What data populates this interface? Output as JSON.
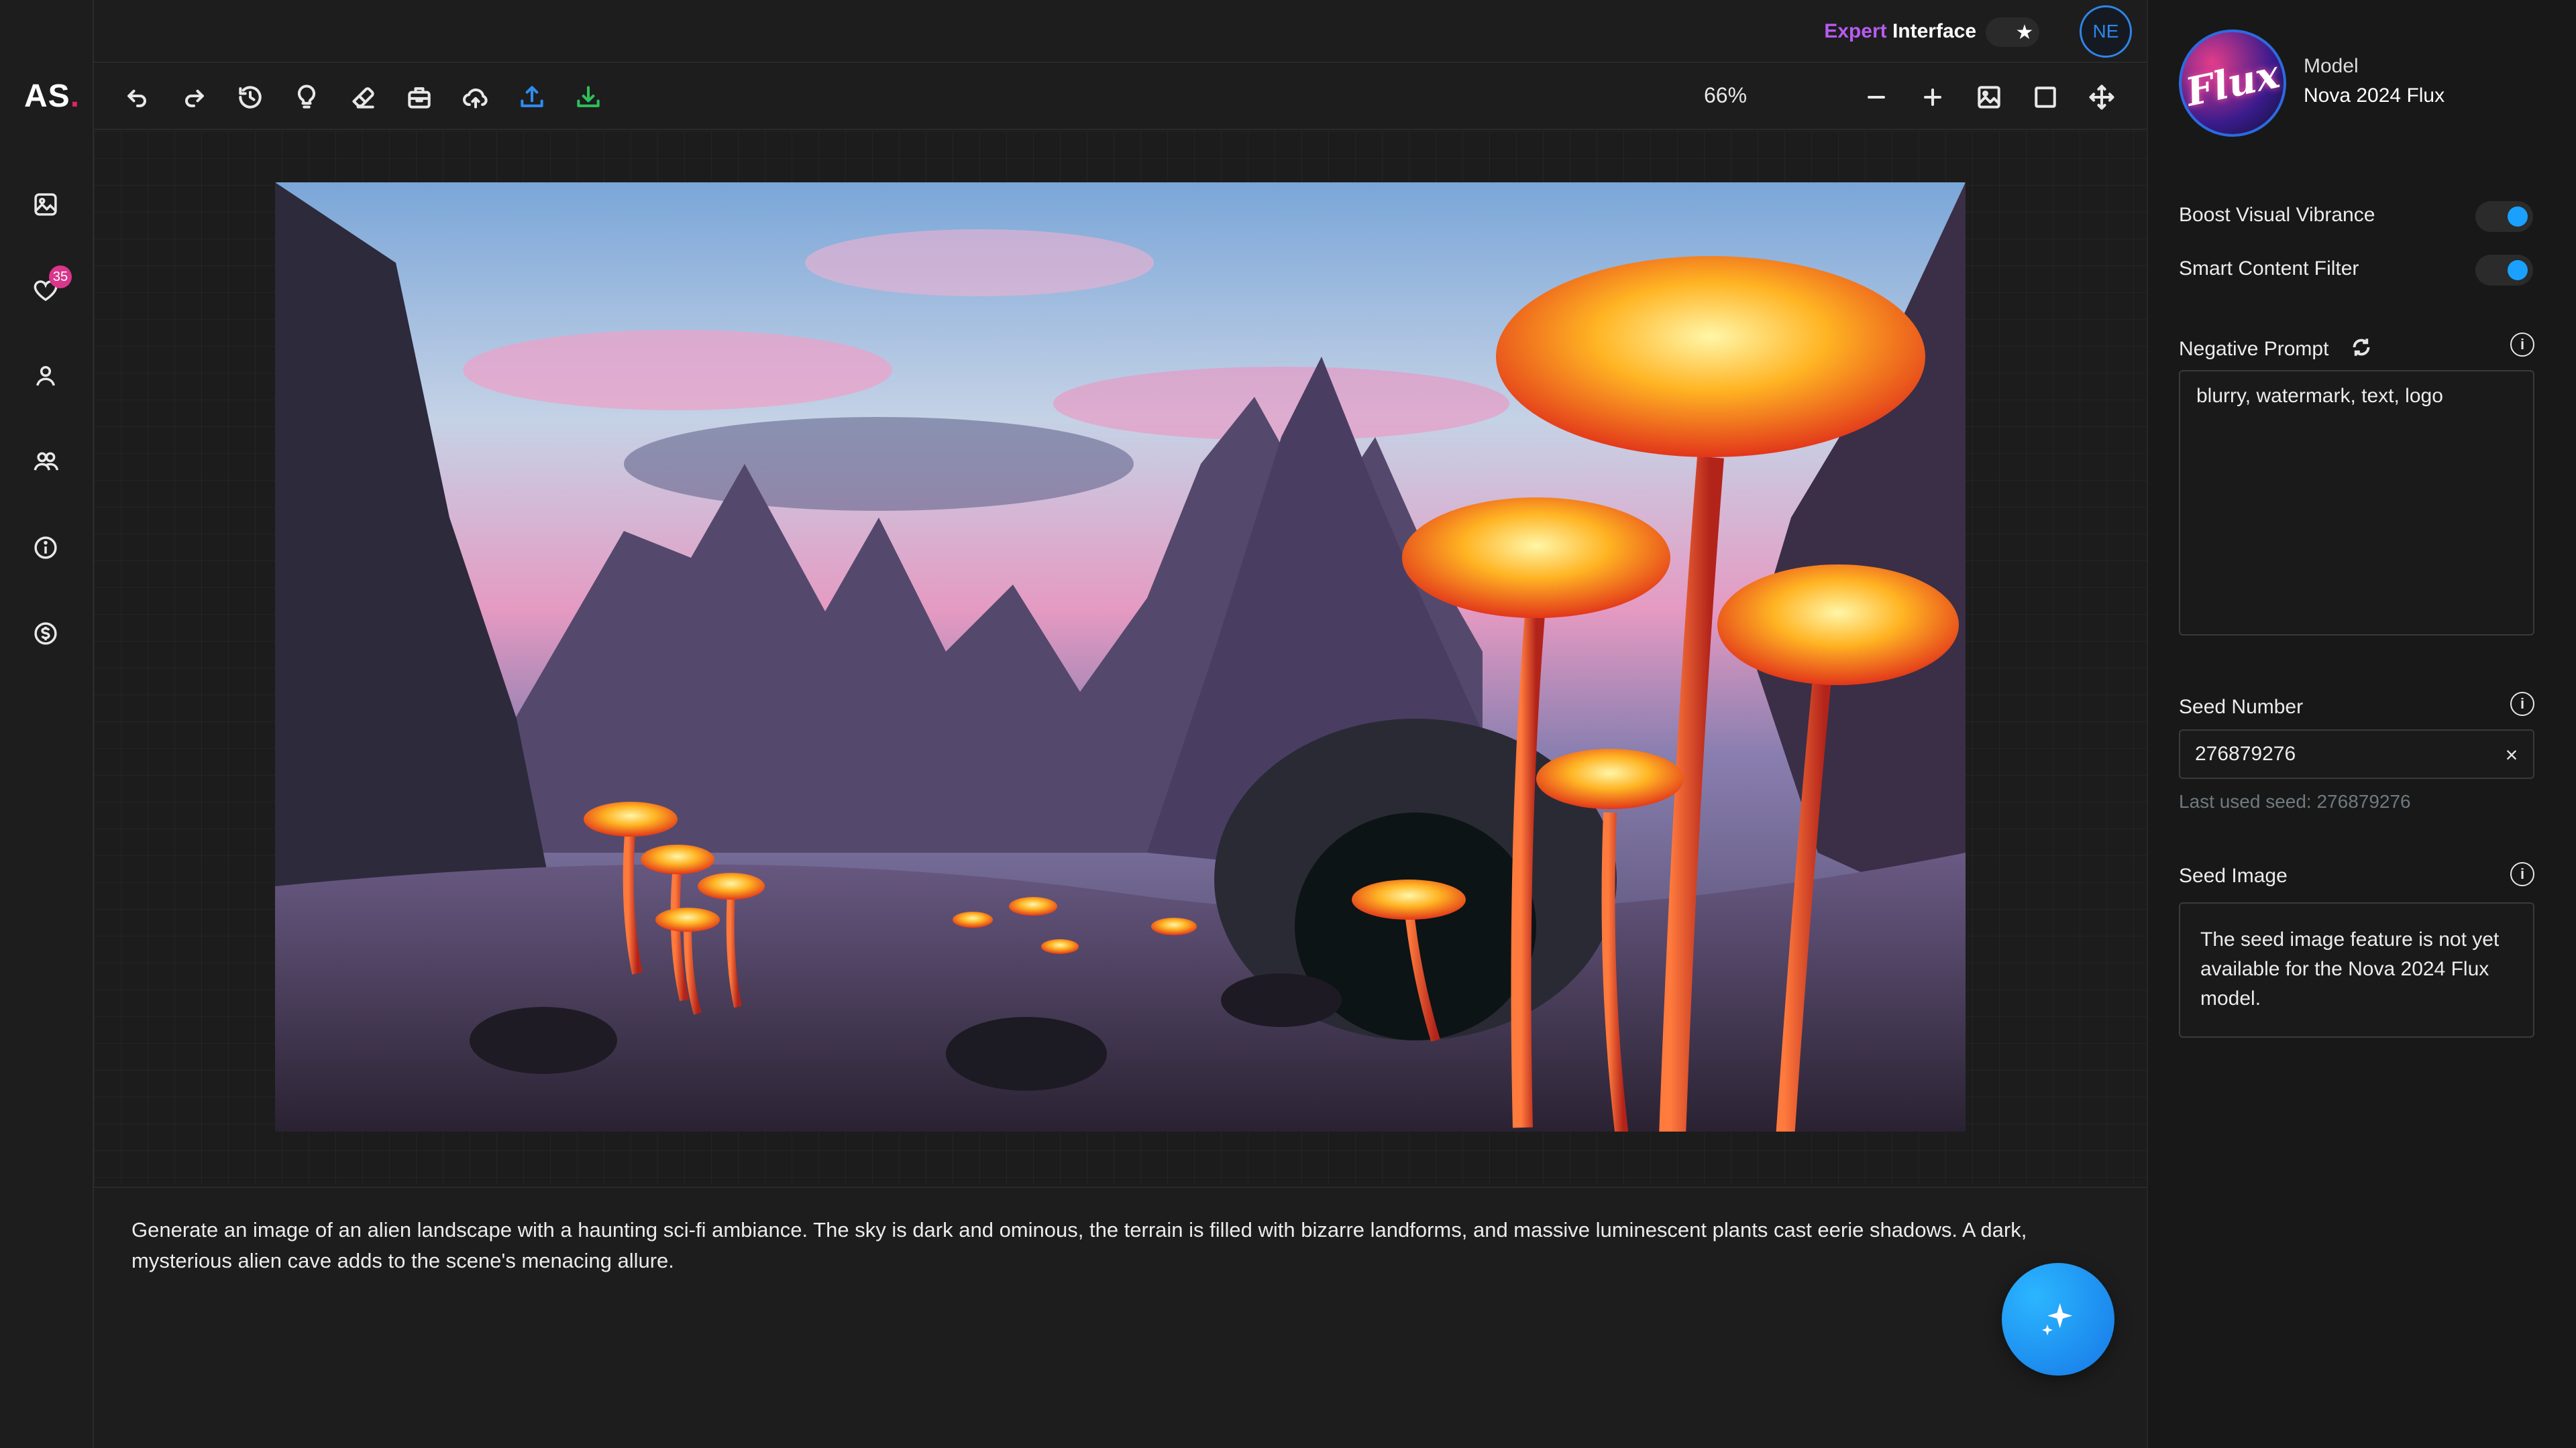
{
  "app": {
    "logo_text": "AS",
    "logo_dot": "."
  },
  "header": {
    "mode_prefix": "Expert",
    "mode_suffix": " Interface",
    "toggle_icon": "star-icon",
    "user_initials": "NE"
  },
  "sidebar": {
    "items": [
      {
        "name": "gallery",
        "icon": "image-icon"
      },
      {
        "name": "favorites",
        "icon": "heart-icon",
        "badge": "35"
      },
      {
        "name": "profile",
        "icon": "user-icon"
      },
      {
        "name": "community",
        "icon": "users-icon"
      },
      {
        "name": "info",
        "icon": "info-icon"
      },
      {
        "name": "billing",
        "icon": "dollar-icon"
      }
    ]
  },
  "toolbar": {
    "tools": [
      "undo-icon",
      "redo-icon",
      "history-icon",
      "lightbulb-icon",
      "eraser-icon",
      "briefcase-icon",
      "cloud-upload-icon",
      "upload-icon",
      "download-icon"
    ],
    "zoom": "66%",
    "right_tools": [
      "zoom-out-icon",
      "zoom-in-icon",
      "image-icon",
      "square-icon",
      "move-icon"
    ]
  },
  "prompt": {
    "text": "Generate an image of an alien landscape with a haunting sci-fi ambiance. The sky is dark and ominous, the terrain is filled with bizarre landforms, and massive luminescent plants cast eerie shadows. A dark, mysterious alien cave adds to the scene's menacing allure."
  },
  "panel": {
    "model_caption": "Model",
    "model_name": "Nova 2024 Flux",
    "model_logo_text": "Flux",
    "options": [
      {
        "label": "Boost Visual Vibrance",
        "enabled": true
      },
      {
        "label": "Smart Content Filter",
        "enabled": true
      }
    ],
    "negative_prompt": {
      "label": "Negative Prompt",
      "value": "blurry, watermark, text, logo"
    },
    "seed": {
      "label": "Seed Number",
      "value": "276879276",
      "last_used": "Last used seed: 276879276"
    },
    "seed_image": {
      "label": "Seed Image",
      "message": "The seed image feature is not yet available for the Nova 2024 Flux model."
    }
  },
  "colors": {
    "accent": "#1aa1ff",
    "expert": "#b65cf0",
    "badge": "#d9368b",
    "avatar_ring": "#2f86e8"
  }
}
